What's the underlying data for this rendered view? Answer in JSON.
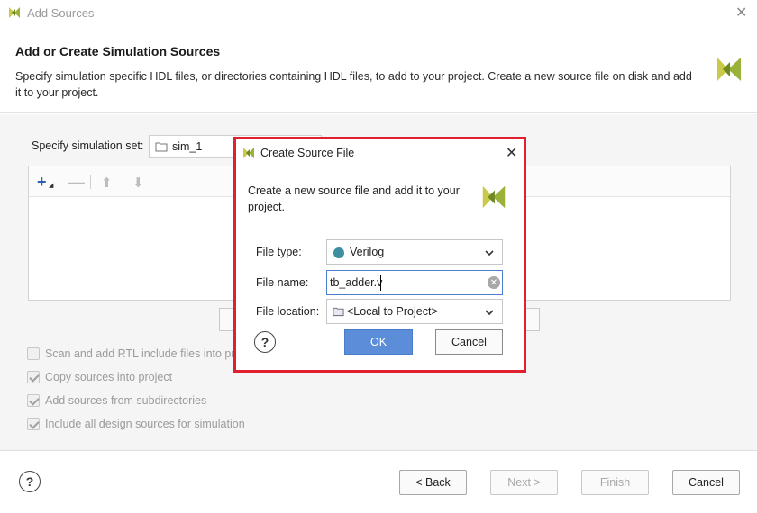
{
  "window": {
    "title": "Add Sources"
  },
  "header": {
    "title": "Add or Create Simulation Sources",
    "description": "Specify simulation specific HDL files, or directories containing HDL files, to add to your project. Create a new source file on disk and add it to your project."
  },
  "simulation_set": {
    "label": "Specify simulation set:",
    "value": "sim_1"
  },
  "options": [
    {
      "label": "Scan and add RTL include files into project",
      "checked": false
    },
    {
      "label": "Copy sources into project",
      "checked": true
    },
    {
      "label": "Add sources from subdirectories",
      "checked": true
    },
    {
      "label": "Include all design sources for simulation",
      "checked": true
    }
  ],
  "footer": {
    "back": "< Back",
    "next": "Next >",
    "finish": "Finish",
    "cancel": "Cancel"
  },
  "dialog": {
    "title": "Create Source File",
    "description": "Create a new source file and add it to your project.",
    "file_type_label": "File type:",
    "file_type_value": "Verilog",
    "file_name_label": "File name:",
    "file_name_value": "tb_adder.v",
    "file_location_label": "File location:",
    "file_location_value": "<Local to Project>",
    "ok": "OK",
    "cancel": "Cancel"
  },
  "colors": {
    "highlight_border": "#e0202e",
    "ok_button": "#5b8dd9",
    "verilog_dot": "#3d8fa0",
    "logo_green": "#9bb23a"
  }
}
